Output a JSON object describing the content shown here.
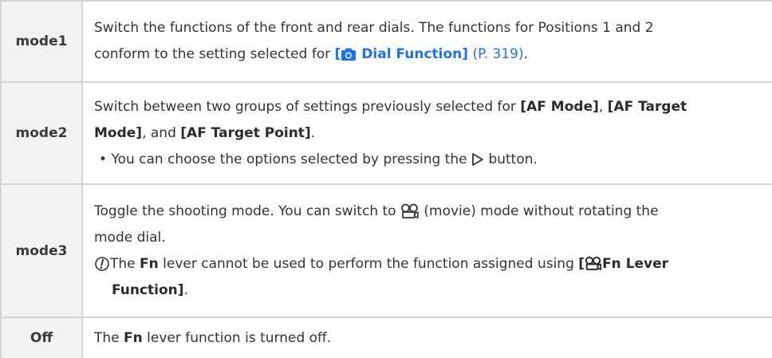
{
  "rows": [
    {
      "key": "mode1",
      "line1": "Switch the functions of the front and rear dials. The functions for Positions 1 and 2",
      "line2_pre": "conform to the setting selected for ",
      "line2_link_open": "[",
      "line2_link_text": " Dial Function]",
      "line2_ref": "(P. 319)",
      "line2_end": "."
    },
    {
      "key": "mode2",
      "line1_pre": "Switch between two groups of settings previously selected for ",
      "line1_b1": "[AF Mode]",
      "line1_mid": ", ",
      "line1_b2": "[AF Target",
      "line2_b2": "Mode]",
      "line2_mid": ", and ",
      "line2_b3": "[AF Target Point]",
      "line2_end": ".",
      "bullet": "•",
      "bullet_pre": "You can choose the options selected by pressing the ",
      "bullet_post": " button."
    },
    {
      "key": "mode3",
      "line1_pre": "Toggle the shooting mode. You can switch to ",
      "line1_post": " (movie) mode without rotating the",
      "line2": "mode dial.",
      "note_pre": "The ",
      "note_fn": "Fn",
      "note_mid": " lever cannot be used to perform the function assigned using ",
      "note_b_open": "[",
      "note_b_rest": "Fn Lever",
      "note_line2": "Function]",
      "note_end": "."
    },
    {
      "key": "Off",
      "pre": "The ",
      "fn": "Fn",
      "post": " lever function is turned off."
    }
  ]
}
